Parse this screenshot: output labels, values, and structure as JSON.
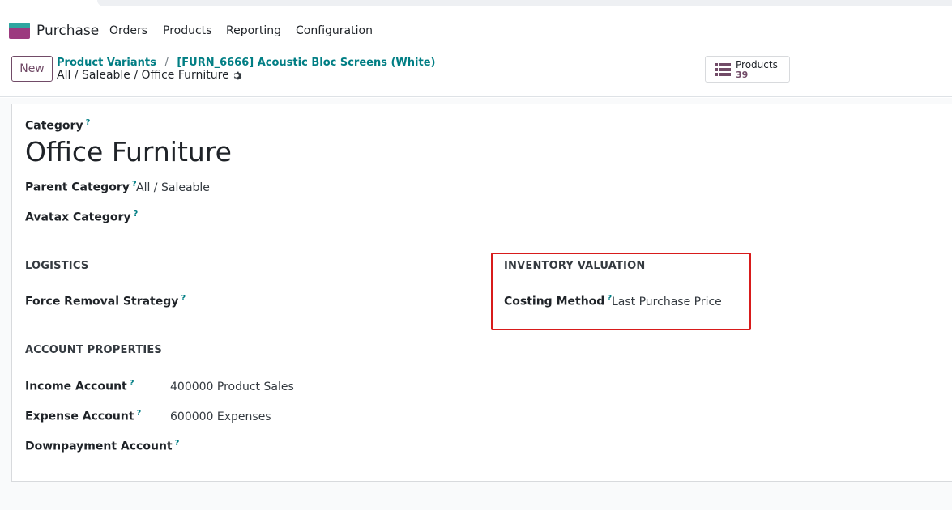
{
  "navbar": {
    "app_name": "Purchase",
    "menu": [
      "Orders",
      "Products",
      "Reporting",
      "Configuration"
    ]
  },
  "control_panel": {
    "new_label": "New",
    "breadcrumb": [
      "Product Variants",
      "[FURN_6666] Acoustic Bloc Screens (White)"
    ],
    "breadcrumb_separator": "/",
    "current": "All / Saleable / Office Furniture",
    "smart_button": {
      "label": "Products",
      "count": "39",
      "icon": "list-icon"
    }
  },
  "form": {
    "category_label": "Category",
    "category_name": "Office Furniture",
    "help_marker": "?",
    "parent_category_label": "Parent Category",
    "parent_category_value": "All / Saleable",
    "avatax_category_label": "Avatax Category",
    "logistics": {
      "title": "LOGISTICS",
      "force_removal_label": "Force Removal Strategy"
    },
    "inventory_valuation": {
      "title": "INVENTORY VALUATION",
      "costing_method_label": "Costing Method",
      "costing_method_value": "Last Purchase Price"
    },
    "account_properties": {
      "title": "ACCOUNT PROPERTIES",
      "income_label": "Income Account",
      "income_value": "400000 Product Sales",
      "expense_label": "Expense Account",
      "expense_value": "600000 Expenses",
      "downpayment_label": "Downpayment Account"
    }
  },
  "colors": {
    "brand": "#714b67",
    "link": "#017e84",
    "highlight": "#d81b1b"
  }
}
